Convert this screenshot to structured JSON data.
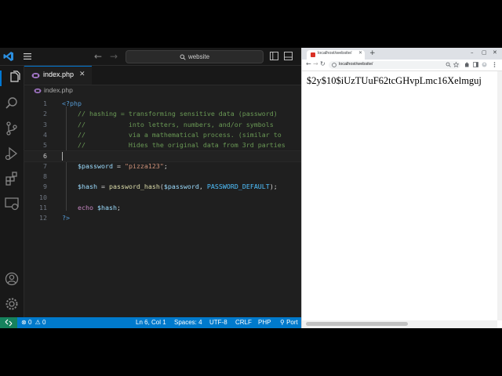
{
  "window": {
    "command_center": "website"
  },
  "editor": {
    "tab": {
      "label": "index.php",
      "close": "✕"
    },
    "breadcrumb": "index.php",
    "lines": [
      {
        "n": "1",
        "tokens": [
          {
            "t": "<?php",
            "c": "t-tag"
          }
        ]
      },
      {
        "n": "2",
        "tokens": [
          {
            "t": "    // hashing = transforming sensitive data (password)",
            "c": "t-com"
          }
        ]
      },
      {
        "n": "3",
        "tokens": [
          {
            "t": "    //           into letters, numbers, and/or symbols",
            "c": "t-com"
          }
        ]
      },
      {
        "n": "4",
        "tokens": [
          {
            "t": "    //           via a mathematical process. (similar to",
            "c": "t-com"
          }
        ]
      },
      {
        "n": "5",
        "tokens": [
          {
            "t": "    //           Hides the original data from 3rd parties",
            "c": "t-com"
          }
        ]
      },
      {
        "n": "6",
        "tokens": []
      },
      {
        "n": "7",
        "tokens": [
          {
            "t": "    ",
            "c": ""
          },
          {
            "t": "$password",
            "c": "t-var"
          },
          {
            "t": " = ",
            "c": ""
          },
          {
            "t": "\"pizza123\"",
            "c": "t-str"
          },
          {
            "t": ";",
            "c": ""
          }
        ]
      },
      {
        "n": "8",
        "tokens": []
      },
      {
        "n": "9",
        "tokens": [
          {
            "t": "    ",
            "c": ""
          },
          {
            "t": "$hash",
            "c": "t-var"
          },
          {
            "t": " = ",
            "c": ""
          },
          {
            "t": "password_hash",
            "c": "t-fn"
          },
          {
            "t": "(",
            "c": ""
          },
          {
            "t": "$password",
            "c": "t-var"
          },
          {
            "t": ", ",
            "c": ""
          },
          {
            "t": "PASSWORD_DEFAULT",
            "c": "t-const"
          },
          {
            "t": ");",
            "c": ""
          }
        ]
      },
      {
        "n": "10",
        "tokens": []
      },
      {
        "n": "11",
        "tokens": [
          {
            "t": "    ",
            "c": ""
          },
          {
            "t": "echo",
            "c": "t-kw"
          },
          {
            "t": " ",
            "c": ""
          },
          {
            "t": "$hash",
            "c": "t-var"
          },
          {
            "t": ";",
            "c": ""
          }
        ]
      },
      {
        "n": "12",
        "tokens": [
          {
            "t": "?>",
            "c": "t-tag"
          }
        ]
      }
    ]
  },
  "statusbar": {
    "problems_errors": "0",
    "problems_warnings": "0",
    "cursor_position": "Ln 6, Col 1",
    "indentation": "Spaces: 4",
    "encoding": "UTF-8",
    "eol": "CRLF",
    "language": "PHP",
    "port": "Port"
  },
  "browser": {
    "tab_title": "localhost/website/",
    "url": "localhost/website/",
    "output_text": "$2y$10$iUzTUuF62tcGHvpLmc16Xelmguj"
  },
  "colors": {
    "accent": "#0078d4",
    "statusbar": "#007acc",
    "remote": "#16825d",
    "editor_bg": "#1f1f1f"
  }
}
